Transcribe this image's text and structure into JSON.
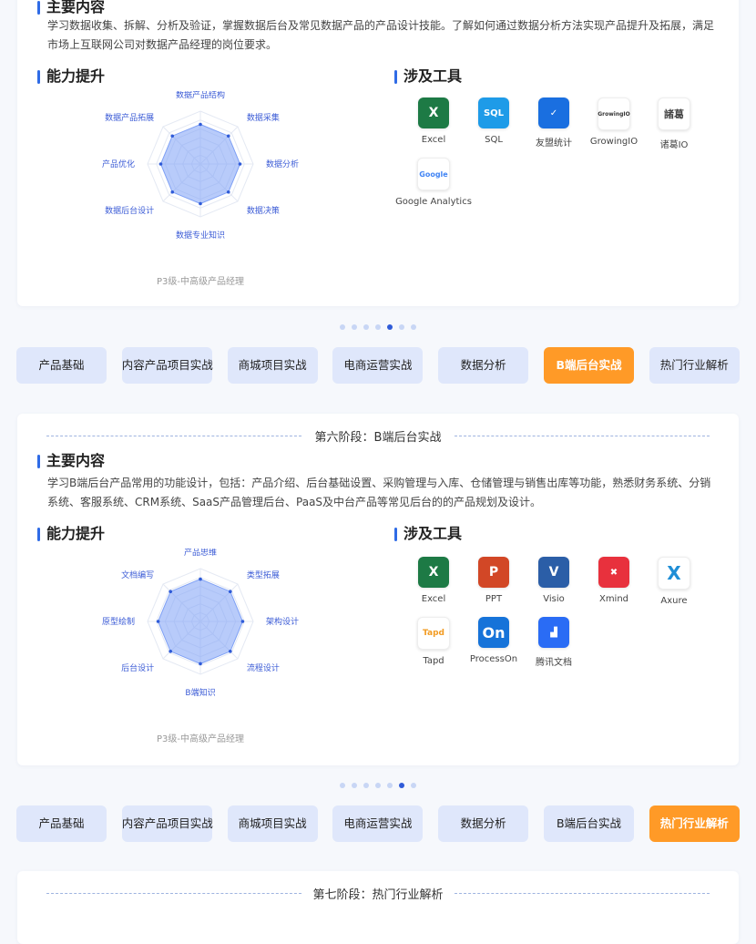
{
  "section1": {
    "main_title": "主要内容",
    "description_lines": [
      "学习数据收集、拆解、分析及验证，掌握数据后台及常见数据产品的产品设计技能。了解如何通过数据分析方法实现产品提升及拓展，满足",
      "市场上互联网公司对数据产品经理的岗位要求。"
    ],
    "ability_title": "能力提升",
    "tools_title": "涉及工具",
    "radar": {
      "labels": [
        "数据产品结构",
        "数据采集",
        "数据分析",
        "数据决策",
        "数据专业知识",
        "数据后台设计",
        "产品优化",
        "数据产品拓展"
      ],
      "values": [
        0.75,
        0.75,
        0.75,
        0.75,
        0.75,
        0.75,
        0.75,
        0.75
      ],
      "caption": "P3级-中高级产品经理"
    },
    "tools": [
      {
        "name": "Excel",
        "icon": "excel-icon",
        "glyph": "X",
        "color": "#1d7a45"
      },
      {
        "name": "SQL",
        "icon": "sql-icon",
        "glyph": "SQL",
        "color": "#1e9be8"
      },
      {
        "name": "友盟统计",
        "icon": "umeng-icon",
        "glyph": "✓",
        "color": "#1a6fe0"
      },
      {
        "name": "GrowingIO",
        "icon": "growingio-icon",
        "glyph": "GrowingIO",
        "color": "#ffffff"
      },
      {
        "name": "诸葛IO",
        "icon": "zhuge-icon",
        "glyph": "諸葛",
        "color": "#ffffff"
      },
      {
        "name": "Google Analytics",
        "icon": "google-icon",
        "glyph": "Google",
        "color": "#ffffff"
      }
    ]
  },
  "nav_top": {
    "active": 5,
    "dots_count": 7,
    "dots_active": 4,
    "tabs": [
      "产品基础",
      "内容产品项目实战",
      "商城项目实战",
      "电商运营实战",
      "数据分析",
      "B端后台实战",
      "热门行业解析"
    ]
  },
  "section2": {
    "stage_title": "第六阶段：B端后台实战",
    "main_title": "主要内容",
    "description_lines": [
      "学习B端后台产品常用的功能设计，包括：产品介绍、后台基础设置、采购管理与入库、仓储管理与销售出库等功能，熟悉财务系统、分销",
      "系统、客服系统、CRM系统、SaaS产品管理后台、PaaS及中台产品等常见后台的的产品规划及设计。"
    ],
    "ability_title": "能力提升",
    "tools_title": "涉及工具",
    "radar": {
      "labels": [
        "产品思维",
        "类型拓展",
        "架构设计",
        "流程设计",
        "B端知识",
        "后台设计",
        "原型绘制",
        "文档编写"
      ],
      "values": [
        0.8,
        0.8,
        0.8,
        0.8,
        0.8,
        0.8,
        0.8,
        0.8
      ],
      "caption": "P3级-中高级产品经理"
    },
    "tools": [
      {
        "name": "Excel",
        "icon": "excel-icon",
        "glyph": "X",
        "color": "#1d7a45"
      },
      {
        "name": "PPT",
        "icon": "powerpoint-icon",
        "glyph": "P",
        "color": "#d24726"
      },
      {
        "name": "Visio",
        "icon": "visio-icon",
        "glyph": "V",
        "color": "#2b5ea7"
      },
      {
        "name": "Xmind",
        "icon": "xmind-icon",
        "glyph": "✖",
        "color": "#e8313d"
      },
      {
        "name": "Axure",
        "icon": "axure-icon",
        "glyph": "X",
        "color": "#ffffff"
      },
      {
        "name": "Tapd",
        "icon": "tapd-icon",
        "glyph": "Tapd",
        "color": "#ffffff"
      },
      {
        "name": "ProcessOn",
        "icon": "processon-icon",
        "glyph": "On",
        "color": "#1673d9"
      },
      {
        "name": "腾讯文档",
        "icon": "tencent-docs-icon",
        "glyph": "▟",
        "color": "#2a6cf5"
      }
    ]
  },
  "nav_bottom": {
    "active": 6,
    "dots_count": 7,
    "dots_active": 5,
    "tabs": [
      "产品基础",
      "内容产品项目实战",
      "商城项目实战",
      "电商运营实战",
      "数据分析",
      "B端后台实战",
      "热门行业解析"
    ]
  },
  "section3": {
    "stage_title": "第七阶段：热门行业解析"
  }
}
